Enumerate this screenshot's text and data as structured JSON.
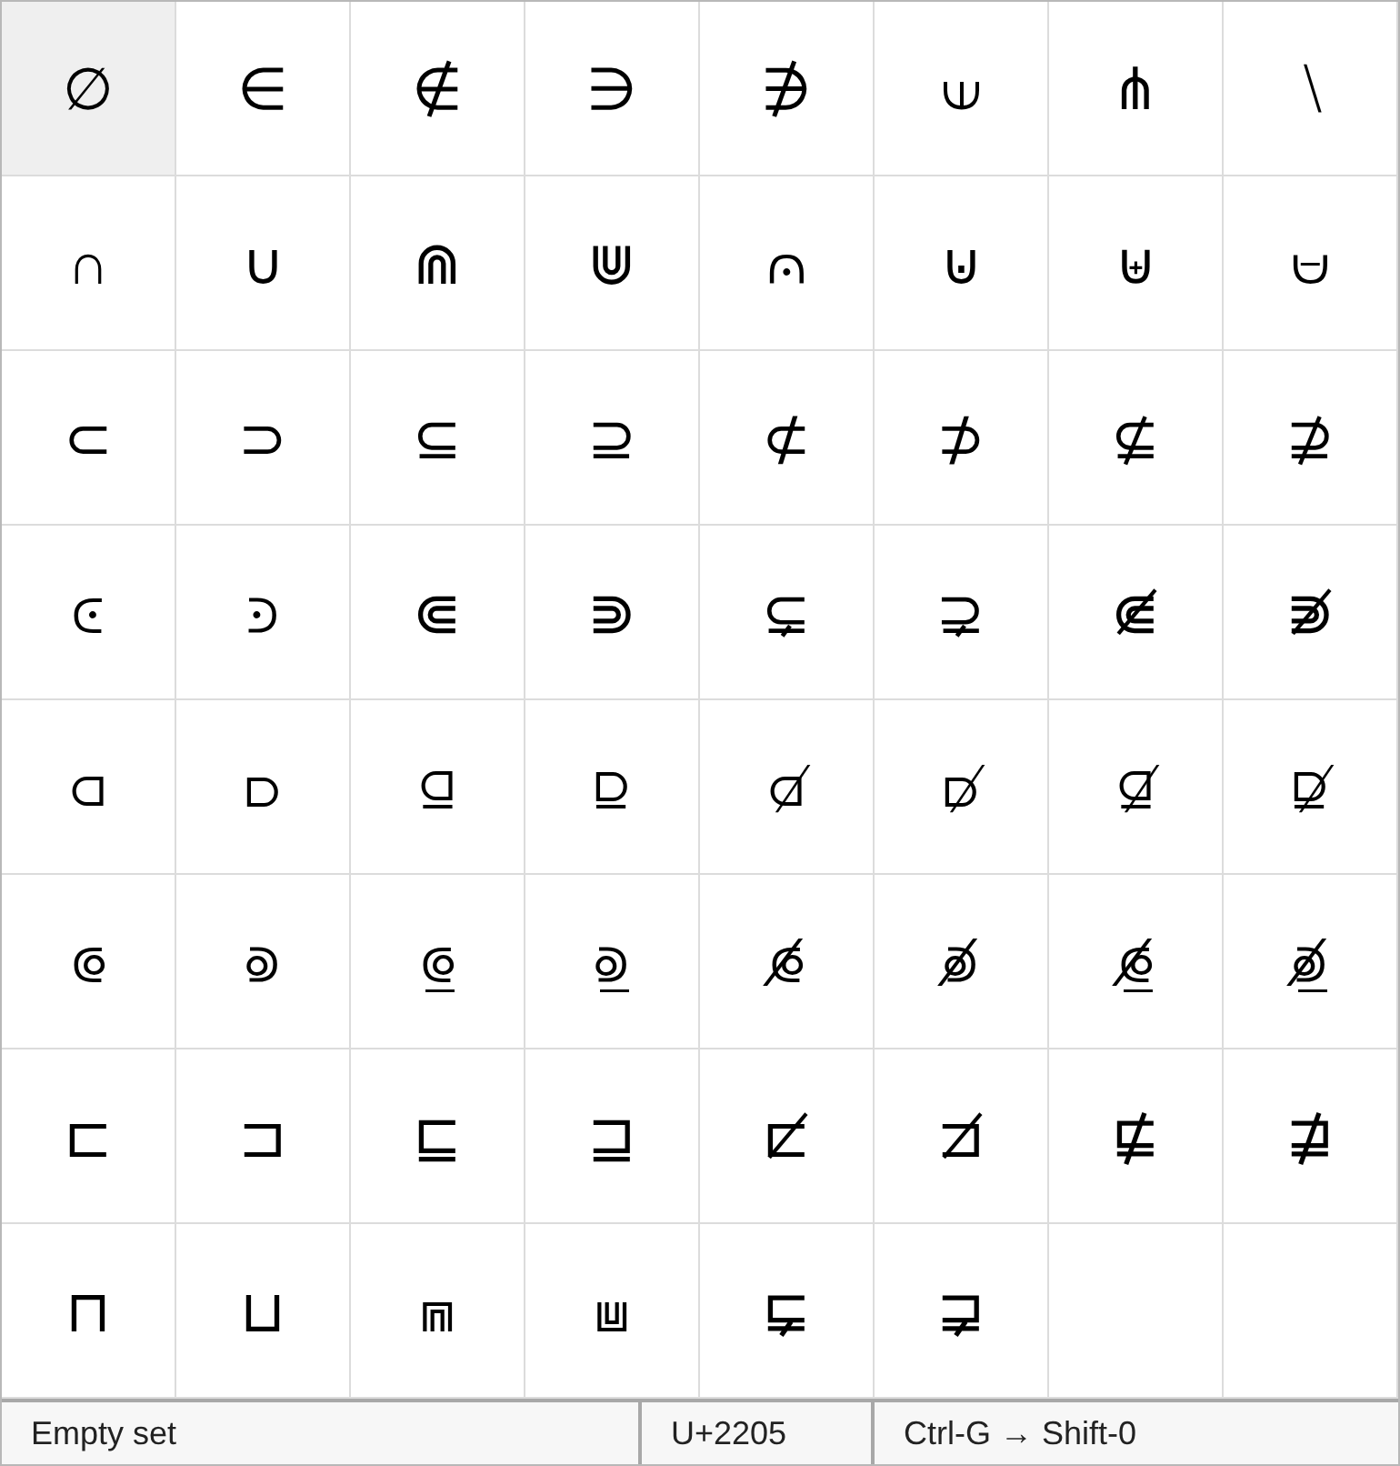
{
  "grid": [
    {
      "glyph": "∅",
      "selected": true
    },
    {
      "glyph": "∈",
      "selected": false
    },
    {
      "glyph": "∉",
      "selected": false
    },
    {
      "glyph": "∋",
      "selected": false
    },
    {
      "glyph": "∌",
      "selected": false
    },
    {
      "glyph": "⟒",
      "selected": false
    },
    {
      "glyph": "⋔",
      "selected": false
    },
    {
      "glyph": "∖",
      "selected": false
    },
    {
      "glyph": "∩",
      "selected": false
    },
    {
      "glyph": "∪",
      "selected": false
    },
    {
      "glyph": "⋒",
      "selected": false
    },
    {
      "glyph": "⋓",
      "selected": false
    },
    {
      "glyph": "⩀",
      "selected": false
    },
    {
      "glyph": "⊍",
      "selected": false
    },
    {
      "glyph": "⊎",
      "selected": false
    },
    {
      "glyph": "⩁",
      "selected": false
    },
    {
      "glyph": "⊂",
      "selected": false
    },
    {
      "glyph": "⊃",
      "selected": false
    },
    {
      "glyph": "⊆",
      "selected": false
    },
    {
      "glyph": "⊇",
      "selected": false
    },
    {
      "glyph": "⊄",
      "selected": false
    },
    {
      "glyph": "⊅",
      "selected": false
    },
    {
      "glyph": "⊈",
      "selected": false
    },
    {
      "glyph": "⊉",
      "selected": false
    },
    {
      "glyph": "⪽",
      "selected": false
    },
    {
      "glyph": "⪾",
      "selected": false
    },
    {
      "glyph": "⋐",
      "selected": false
    },
    {
      "glyph": "⋑",
      "selected": false
    },
    {
      "glyph": "⊊",
      "selected": false
    },
    {
      "glyph": "⊋",
      "selected": false
    },
    {
      "glyph": "⋐̸",
      "selected": false
    },
    {
      "glyph": "⋑̸",
      "selected": false
    },
    {
      "glyph": "⫏",
      "selected": false
    },
    {
      "glyph": "⫐",
      "selected": false
    },
    {
      "glyph": "⫑",
      "selected": false
    },
    {
      "glyph": "⫒",
      "selected": false
    },
    {
      "glyph": "⫏̸",
      "selected": false
    },
    {
      "glyph": "⫐̸",
      "selected": false
    },
    {
      "glyph": "⫑̸",
      "selected": false
    },
    {
      "glyph": "⫒̸",
      "selected": false
    },
    {
      "glyph": "⟃",
      "selected": false
    },
    {
      "glyph": "⟄",
      "selected": false
    },
    {
      "glyph": "⟃̲",
      "selected": false
    },
    {
      "glyph": "⟄̲",
      "selected": false
    },
    {
      "glyph": "⟃̸",
      "selected": false
    },
    {
      "glyph": "⟄̸",
      "selected": false
    },
    {
      "glyph": "⟃̸̲",
      "selected": false
    },
    {
      "glyph": "⟄̸̲",
      "selected": false
    },
    {
      "glyph": "⊏",
      "selected": false
    },
    {
      "glyph": "⊐",
      "selected": false
    },
    {
      "glyph": "⊑",
      "selected": false
    },
    {
      "glyph": "⊒",
      "selected": false
    },
    {
      "glyph": "⊏̸",
      "selected": false
    },
    {
      "glyph": "⊐̸",
      "selected": false
    },
    {
      "glyph": "⋢",
      "selected": false
    },
    {
      "glyph": "⋣",
      "selected": false
    },
    {
      "glyph": "⊓",
      "selected": false
    },
    {
      "glyph": "⊔",
      "selected": false
    },
    {
      "glyph": "⩎",
      "selected": false
    },
    {
      "glyph": "⩏",
      "selected": false
    },
    {
      "glyph": "⋤",
      "selected": false
    },
    {
      "glyph": "⋥",
      "selected": false
    }
  ],
  "status_bar": {
    "name": "Empty set",
    "code": "U+2205",
    "shortcut": "Ctrl-G → Shift-0"
  }
}
